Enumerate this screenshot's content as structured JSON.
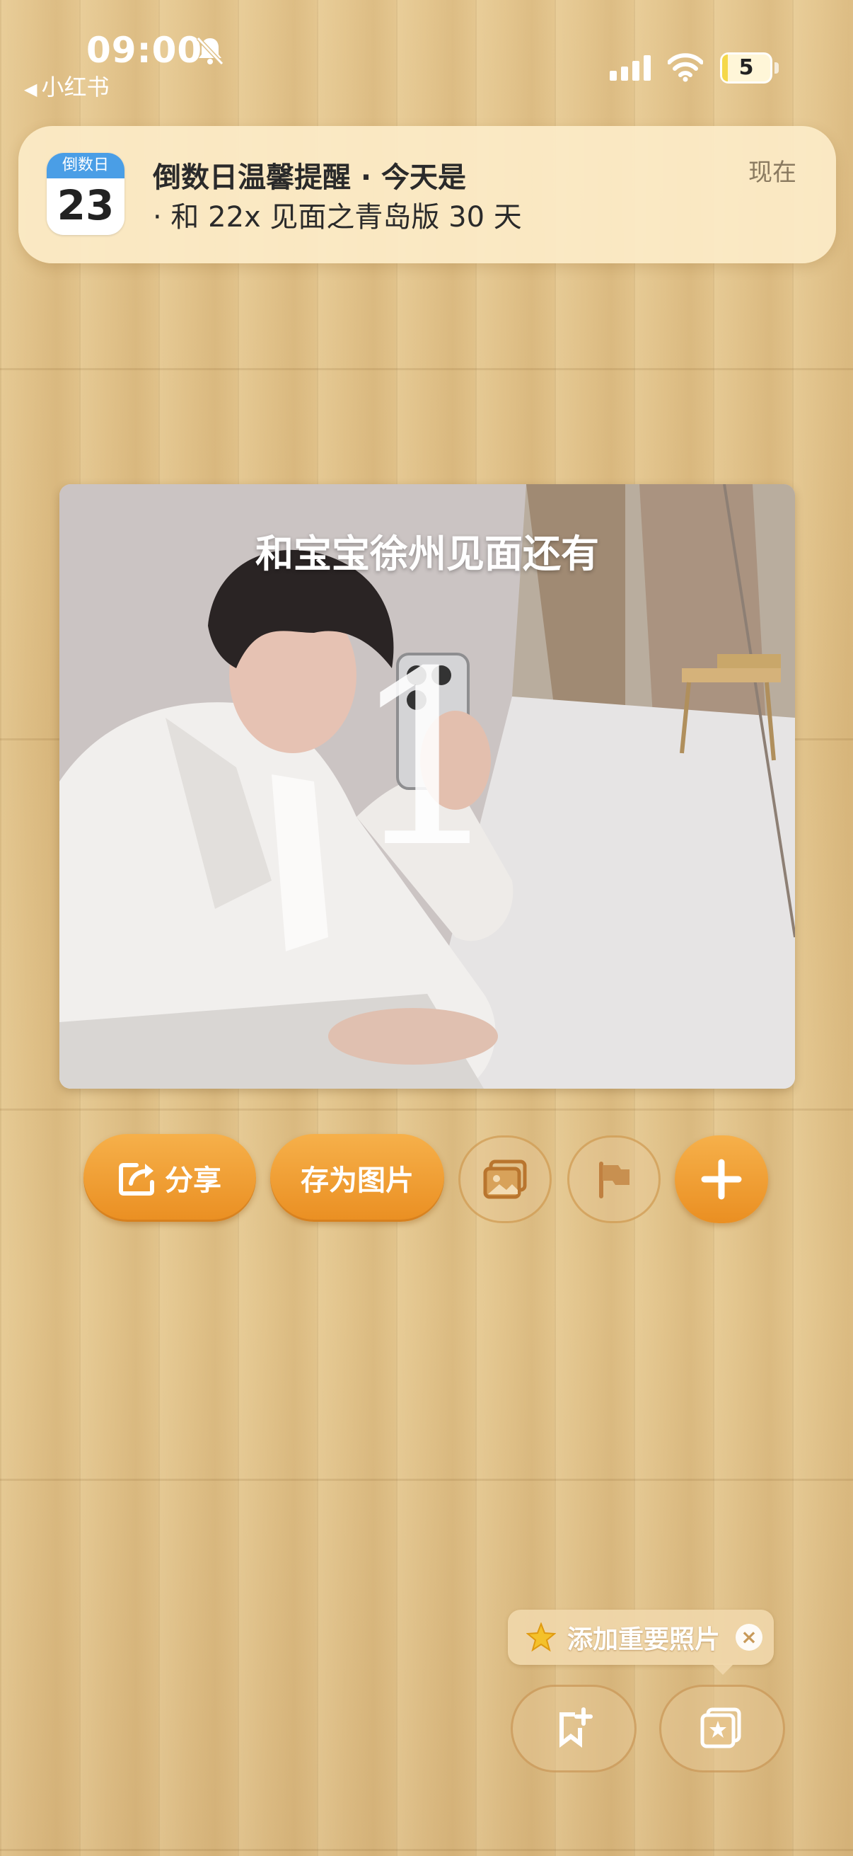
{
  "status_bar": {
    "time": "09:00",
    "back_app": "小红书",
    "battery": "5",
    "icons": [
      "bell-off-icon",
      "signal-icon",
      "wifi-icon",
      "battery-icon"
    ]
  },
  "notification": {
    "app_icon_label": "倒数日",
    "app_icon_day": "23",
    "title": "倒数日温馨提醒 · 今天是",
    "body": "· 和 22x 见面之青岛版 30 天",
    "time": "现在"
  },
  "photo_card": {
    "caption": "和宝宝徐州见面还有",
    "days_number": "1"
  },
  "actions": {
    "share_label": "分享",
    "save_image_label": "存为图片",
    "icons": [
      "share-icon",
      "photo-icon",
      "flag-icon",
      "plus-icon"
    ]
  },
  "tip": {
    "label": "添加重要照片",
    "icons": [
      "star-icon",
      "close-icon"
    ]
  },
  "bottom_buttons": {
    "icons": [
      "add-bookmark-icon",
      "starred-photos-icon"
    ]
  },
  "colors": {
    "accent": "#ea8f22",
    "accent_light": "#f6b04a",
    "wood": "#e0c28a",
    "banner": "#fcecc8",
    "calendar_blue": "#4a9ee6"
  }
}
